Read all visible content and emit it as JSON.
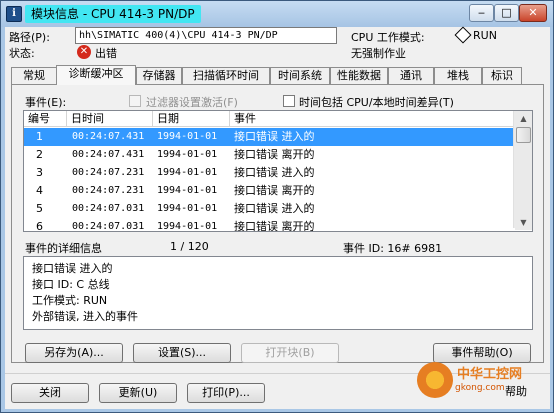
{
  "window": {
    "title": "模块信息 - CPU 414-3 PN/DP",
    "icon_letter": "i",
    "min_glyph": "‒",
    "max_glyph": "□",
    "close_glyph": "✕"
  },
  "info": {
    "path_label": "路径(P):",
    "path_value": "hh\\SIMATIC 400(4)\\CPU 414-3 PN/DP",
    "status_label": "状态:",
    "status_value": "出错",
    "cpu_mode_label": "CPU 工作模式:",
    "cpu_mode_value": "RUN",
    "force_value": "无强制作业"
  },
  "tabs": [
    {
      "label": "常规"
    },
    {
      "label": "诊断缓冲区"
    },
    {
      "label": "存储器"
    },
    {
      "label": "扫描循环时间"
    },
    {
      "label": "时间系统"
    },
    {
      "label": "性能数据"
    },
    {
      "label": "通讯"
    },
    {
      "label": "堆栈"
    },
    {
      "label": "标识"
    }
  ],
  "events": {
    "label": "事件(E):",
    "filter_label": "过滤器设置激活(F)",
    "time_include_label": "时间包括 CPU/本地时间差异(T)",
    "columns": [
      "编号",
      "日时间",
      "日期",
      "事件"
    ],
    "rows": [
      {
        "no": "1",
        "time": "00:24:07.431",
        "date": "1994-01-01",
        "event": "接口错误  进入的"
      },
      {
        "no": "2",
        "time": "00:24:07.431",
        "date": "1994-01-01",
        "event": "接口错误  离开的"
      },
      {
        "no": "3",
        "time": "00:24:07.231",
        "date": "1994-01-01",
        "event": "接口错误  进入的"
      },
      {
        "no": "4",
        "time": "00:24:07.231",
        "date": "1994-01-01",
        "event": "接口错误  离开的"
      },
      {
        "no": "5",
        "time": "00:24:07.031",
        "date": "1994-01-01",
        "event": "接口错误  进入的"
      },
      {
        "no": "6",
        "time": "00:24:07.031",
        "date": "1994-01-01",
        "event": "接口错误  离开的"
      }
    ],
    "selected_row": 1
  },
  "details": {
    "label": "事件的详细信息",
    "counter": "1 / 120",
    "event_id": "事件 ID: 16# 6981",
    "lines": [
      "接口错误 进入的",
      "接口 ID: C 总线",
      "工作模式: RUN",
      "外部错误, 进入的事件"
    ]
  },
  "buttons": {
    "save_as": "另存为(A)...",
    "settings": "设置(S)...",
    "open_block": "打开块(B)",
    "event_help": "事件帮助(O)",
    "close": "关闭",
    "update": "更新(U)",
    "print": "打印(P)...",
    "help": "帮助"
  },
  "watermark": {
    "text": "中华工控网",
    "url": "gkong.com"
  },
  "colors": {
    "title_highlight": "#42e6f2",
    "selection": "#3399ff",
    "error": "#d42a1c"
  }
}
